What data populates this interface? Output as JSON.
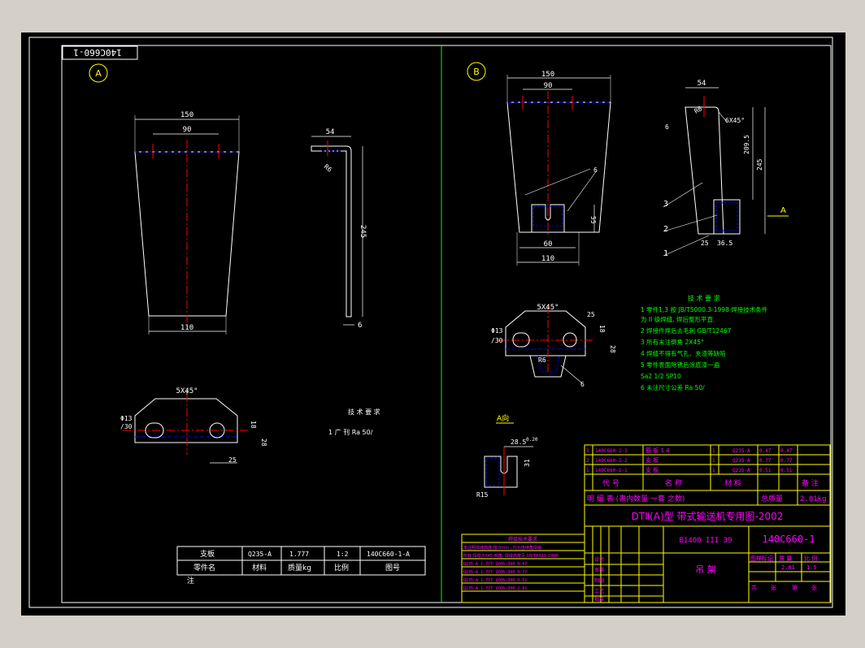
{
  "drawing": {
    "header_code": "140C660-1",
    "view_a_label": "A",
    "view_b_label": "B",
    "view_a_arrow_label": "A",
    "section_a_label": "A向",
    "dims_a": {
      "top_overall": "150",
      "top_inner": "90",
      "bottom_width": "110",
      "bracket_top": "54",
      "bracket_height": "245",
      "thickness": "6",
      "radius": "R6",
      "plan_chamfer": "5X45°",
      "plan_dia1": "Φ13",
      "plan_dia2": "/30",
      "plan_h1": "18",
      "plan_h2": "28",
      "plan_w": "25"
    },
    "dims_b": {
      "top_overall": "150",
      "top_inner": "90",
      "slot_depth": "55",
      "slot_width": "60",
      "bottom_width": "110",
      "side_top": "54",
      "side_radius": "R6",
      "chamfer": "6X45°",
      "side_h1": "209.5",
      "side_h2": "245",
      "side_b1": "25",
      "side_b2": "36.5",
      "weld1": "6",
      "weld2": "6",
      "plan_chamfer": "5X45°",
      "plan_w": "25",
      "plan_dia1": "Φ13",
      "plan_dia2": "/30",
      "plan_h1": "18",
      "plan_h2": "28",
      "plan_r": "R6",
      "sec_w": "28.5",
      "sec_sub": "0.20",
      "sec_h": "31",
      "sec_r": "R15"
    },
    "callouts": [
      "1",
      "2",
      "3"
    ],
    "tech_note_a": [
      "技 术 要 求",
      "1 广 刊 Ra 50/"
    ],
    "tech_requirements": [
      "技  术  要  求",
      "1 零件1,3 按  JB/T5000.3-1998 焊接技术条件",
      "  为 II 级焊缝, 焊后整形平直.",
      "2 焊接件焊后去毛刺 GB/T12467",
      "3 所有未注倒角 2X45°",
      "4 焊缝不得有气孔、夹渣等缺陷",
      "5 零件表面除锈后涂底漆一遍",
      "  Sa2 1/2 SP10",
      "6 未注尺寸公差 Ra 50/"
    ]
  },
  "title_block_a": {
    "rows": [
      [
        "支板",
        "Q235-A",
        "1.777",
        "1:2",
        "140C660-1-A"
      ],
      [
        "零件名",
        "材料",
        "质量kg",
        "比例",
        "图号"
      ]
    ],
    "footer": "注"
  },
  "parts_table": {
    "rows": [
      [
        "3",
        "140C660-1-3",
        "筋 板 1 4",
        "1",
        "Q235-A",
        "0.47",
        "0.47"
      ],
      [
        "2",
        "140C660-1-2",
        "支 板",
        "1",
        "Q235-A",
        "0.77",
        "0.77"
      ],
      [
        "1",
        "140C660-1-1",
        "支 板",
        "1",
        "Q235-A",
        "0.51",
        "0.51"
      ]
    ],
    "header": [
      "代   号",
      "名   称",
      "材   料",
      "备 注"
    ],
    "schedule_title": "明  细  表  (表内数量 一套 之数)",
    "total_weight_label": "总质量",
    "total_weight": "2.81kg",
    "banner": "DTⅡ(A)型  带式输送机专用图-2002",
    "code_left": "B1400  III 39",
    "drawing_no": "140C660-1",
    "part_name": "吊  架",
    "approval_labels": [
      "设计",
      "审核",
      "制图",
      "工艺",
      "批准"
    ],
    "scale_labels": [
      "图样标记",
      "质  量",
      "比  例"
    ],
    "scale_values": [
      "",
      "2.81",
      "1:5"
    ],
    "sheet_labels": [
      "共",
      "张",
      "第",
      "张"
    ]
  },
  "revision_table": {
    "title": "焊接技术要求",
    "rows": [
      "未注明焊缝高度 按 6mm ,  均为连续角焊缝",
      "所有 焊缝 5X45 倒角, 焊缝高度见 CB/T8923-1988",
      "Q235-A  1.777   1Y06-300   0.47",
      "Q235-A  1.777   1Y06-300   0.77",
      "Q235-A  1.777   1Y06-300   0.51",
      "Q235-A  1.777   1Y06-300   2.81"
    ]
  }
}
